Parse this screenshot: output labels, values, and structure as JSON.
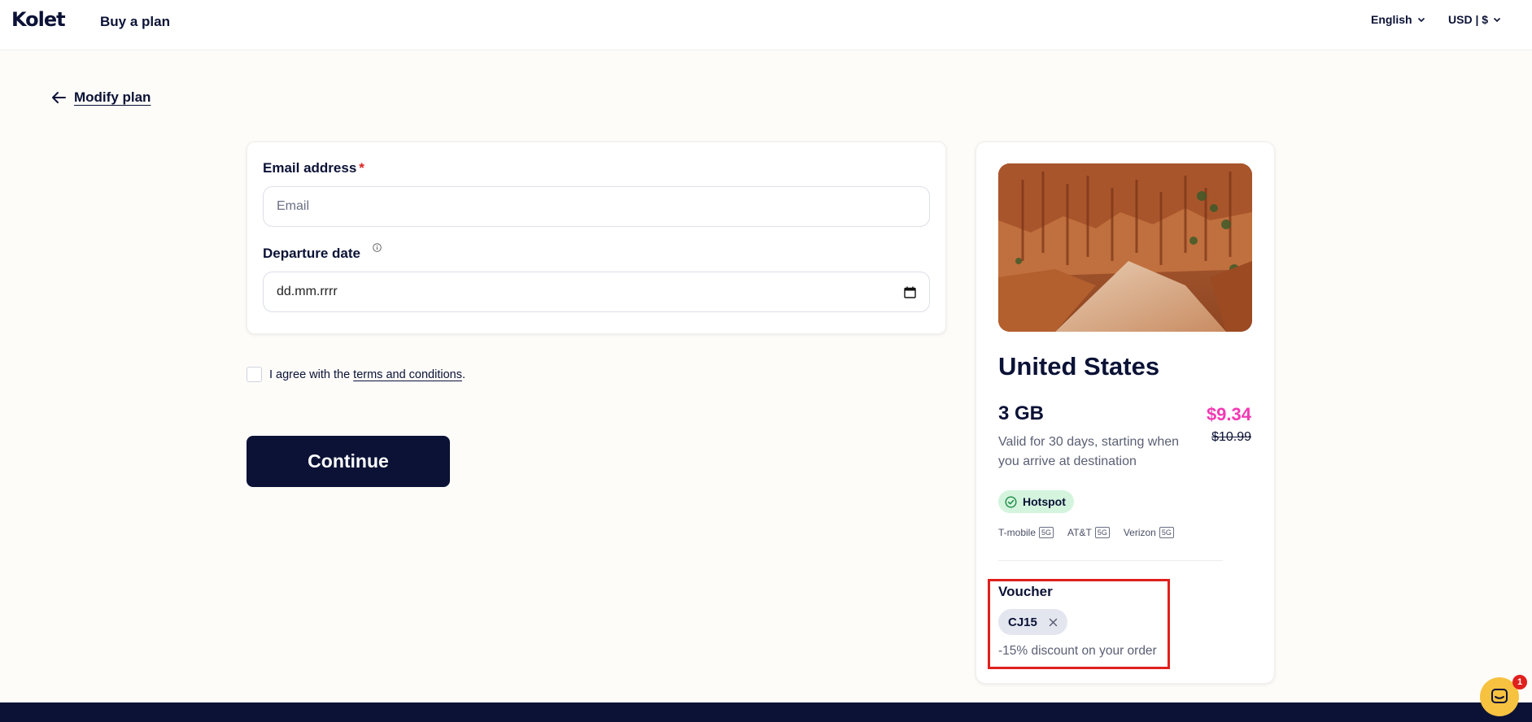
{
  "header": {
    "logo": "Kolet",
    "buy_plan": "Buy a plan",
    "language": "English",
    "currency": "USD | $"
  },
  "nav": {
    "back_label": "Modify plan"
  },
  "form": {
    "email_label": "Email address",
    "email_required_mark": "*",
    "email_placeholder": "Email",
    "email_value": "",
    "departure_label": "Departure date",
    "departure_value": "dd.mm.rrrr"
  },
  "agreement": {
    "prefix": "I agree with the ",
    "link": "terms and conditions",
    "suffix": ".",
    "checked": false
  },
  "continue_label": "Continue",
  "plan": {
    "country": "United States",
    "data_amount": "3 GB",
    "price": "$9.34",
    "old_price": "$10.99",
    "validity": "Valid for 30 days, starting when you arrive at destination",
    "feature": "Hotspot",
    "carriers": [
      {
        "name": "T-mobile",
        "tech": "5G"
      },
      {
        "name": "AT&T",
        "tech": "5G"
      },
      {
        "name": "Verizon",
        "tech": "5G"
      }
    ]
  },
  "voucher": {
    "title": "Voucher",
    "code": "CJ15",
    "note": "-15% discount on your order"
  },
  "chat": {
    "badge_count": "1"
  },
  "colors": {
    "navy": "#0b1236",
    "price_pink": "#f23ab4",
    "hotspot_bg": "#d4f4de",
    "highlight_red": "#e0201d",
    "chat_yellow": "#f7c240"
  }
}
